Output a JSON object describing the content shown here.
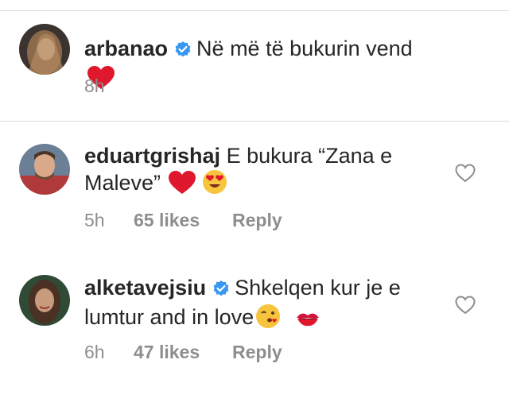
{
  "comments": [
    {
      "username": "arbanao",
      "verified": true,
      "text": "Në më të bukurin vend",
      "emojis": [
        "red-heart"
      ],
      "time": "8h",
      "likes": "",
      "reply": ""
    },
    {
      "username": "eduartgrishaj",
      "verified": false,
      "text_line1": "E bukura “Zana e",
      "text_line2": "Maleve”",
      "emojis": [
        "red-heart",
        "heart-eyes"
      ],
      "time": "5h",
      "likes": "65 likes",
      "reply": "Reply"
    },
    {
      "username": "alketavejsiu",
      "verified": true,
      "text_line1": "Shkelqen kur je e",
      "text_line2": "lumtur and in love",
      "emojis": [
        "kissing-face",
        "kiss-mark"
      ],
      "time": "6h",
      "likes": "47 likes",
      "reply": "Reply"
    }
  ],
  "colors": {
    "verified": "#3897f0",
    "heart": "#e0182d",
    "muted": "#8e8e8e",
    "divider": "#dbdbdb"
  }
}
